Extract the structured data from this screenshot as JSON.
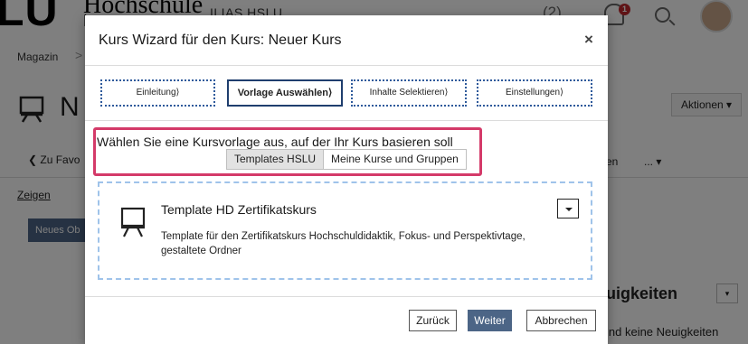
{
  "background": {
    "logo": "LU",
    "logo_sub": "Hochschule",
    "logo_sub2": "L",
    "app_name": "ILIAS HSLU",
    "count": "(2)",
    "notification_badge": "1",
    "breadcrumb_first": "Magazin",
    "breadcrumb_sep": ">",
    "page_title": "N",
    "actions_label": "Aktionen ▾",
    "back_label": "❮ Zu Favo",
    "right_tab": "en",
    "more_tab": "... ▾",
    "zeigen_label": "Zeigen",
    "zeigen_trunc": "V",
    "new_object_label": "Neues Ob",
    "news_title": "uigkeiten",
    "news_text": "ind keine Neuigkeiten"
  },
  "modal": {
    "title": "Kurs Wizard für den Kurs: Neuer Kurs",
    "close_glyph": "×",
    "steps": [
      {
        "label": "Einleitung"
      },
      {
        "label": "Vorlage Auswählen"
      },
      {
        "label": "Inhalte Selektieren"
      },
      {
        "label": "Einstellungen"
      }
    ],
    "prompt": "Wählen Sie eine Kursvorlage aus, auf der Ihr Kurs basieren soll",
    "tabs": [
      "Templates HSLU",
      "Meine Kurse und Gruppen"
    ],
    "template": {
      "title": "Template HD Zertifikatskurs",
      "description": "Template für den Zertifikatskurs Hochschuldidaktik, Fokus- und Perspektivtage, gestaltete Ordner"
    },
    "buttons": {
      "back": "Zurück",
      "next": "Weiter",
      "cancel": "Abbrechen"
    }
  }
}
